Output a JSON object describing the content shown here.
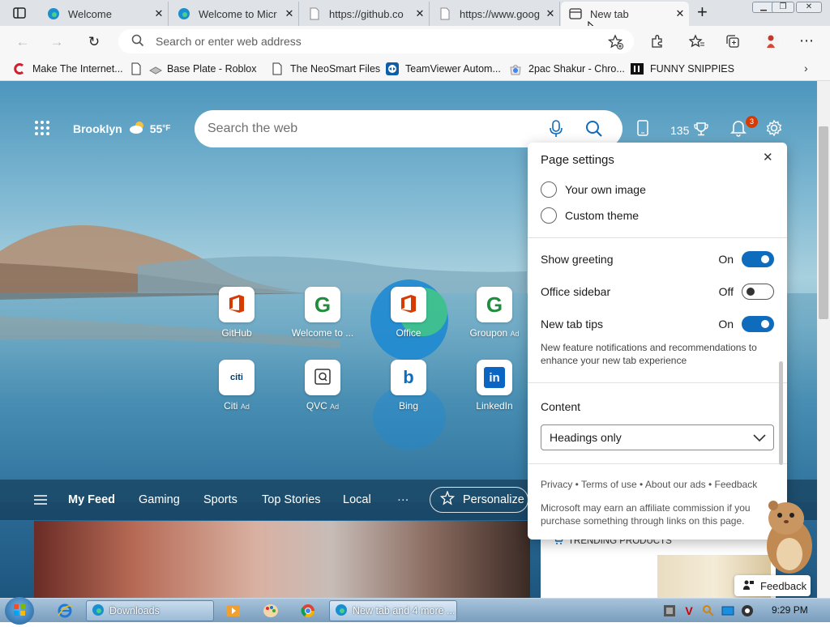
{
  "tabs": [
    {
      "title": "Welcome",
      "active": false
    },
    {
      "title": "Welcome to Micr",
      "active": false
    },
    {
      "title": "https://github.co",
      "active": false
    },
    {
      "title": "https://www.goog",
      "active": false
    },
    {
      "title": "New tab",
      "active": true
    }
  ],
  "address_bar": {
    "placeholder": "Search or enter web address"
  },
  "favorites": [
    {
      "label": "Make The Internet...",
      "icon": "c-logo-icon"
    },
    {
      "label": "Base Plate - Roblox",
      "icon": "page-icon"
    },
    {
      "label": "The NeoSmart Files",
      "icon": "page-icon"
    },
    {
      "label": "TeamViewer Autom...",
      "icon": "teamviewer-icon"
    },
    {
      "label": "2pac Shakur - Chro...",
      "icon": "chrome-web-store-icon"
    },
    {
      "label": "FUNNY SNIPPIES",
      "icon": "imdb-icon"
    }
  ],
  "weather": {
    "city": "Brooklyn",
    "temp": "55",
    "unit": "°F"
  },
  "search": {
    "placeholder": "Search the web"
  },
  "rewards_points": "135",
  "notifications_count": "3",
  "quick_links": [
    {
      "label": "GitHub",
      "ad": "",
      "icon": "office-icon"
    },
    {
      "label": "Welcome to ...",
      "ad": "",
      "icon": "google-g-icon"
    },
    {
      "label": "Office",
      "ad": "",
      "icon": "office-icon"
    },
    {
      "label": "Groupon",
      "ad": "Ad",
      "icon": "google-g-icon"
    },
    {
      "label": "Citi",
      "ad": "Ad",
      "icon": "citi-icon"
    },
    {
      "label": "QVC",
      "ad": "Ad",
      "icon": "qvc-icon"
    },
    {
      "label": "Bing",
      "ad": "",
      "icon": "bing-icon"
    },
    {
      "label": "LinkedIn",
      "ad": "",
      "icon": "linkedin-icon"
    }
  ],
  "feed_tabs": [
    "My Feed",
    "Gaming",
    "Sports",
    "Top Stories",
    "Local",
    "···"
  ],
  "personalize_label": "Personalize",
  "trending_label": "TRENDING PRODUCTS",
  "page_settings": {
    "title": "Page settings",
    "background_options": [
      "Your own image",
      "Custom theme"
    ],
    "toggles": [
      {
        "label": "Show greeting",
        "state": "On",
        "on": true
      },
      {
        "label": "Office sidebar",
        "state": "Off",
        "on": false
      },
      {
        "label": "New tab tips",
        "state": "On",
        "on": true
      }
    ],
    "tips_description": "New feature notifications and recommendations to enhance your new tab experience",
    "content_heading": "Content",
    "content_value": "Headings only",
    "footer_links": [
      "Privacy",
      "Terms of use",
      "About our ads",
      "Feedback"
    ],
    "disclaimer": "Microsoft may earn an affiliate commission if you purchase something through links on this page."
  },
  "feedback_button": "Feedback",
  "taskbar": {
    "items": [
      {
        "label": "Downloads",
        "icon": "edge-icon"
      },
      {
        "label": "New tab and 4 more ...",
        "icon": "edge-icon"
      }
    ],
    "clock": "9:29 PM"
  },
  "colors": {
    "accent": "#0f6cbd",
    "notification_badge": "#d83b01"
  }
}
